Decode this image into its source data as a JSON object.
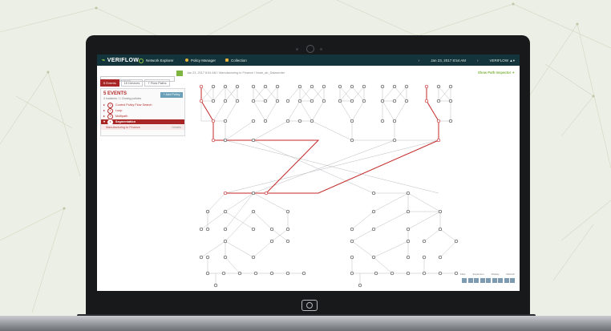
{
  "colors": {
    "accent": "#8fc73e",
    "topbar": "#12343a",
    "danger": "#a82626",
    "node": "#444",
    "path": "#c42a2a"
  },
  "app": {
    "logo": "VERIFLOW"
  },
  "nav": {
    "items": [
      {
        "label": "Network Explorer",
        "icon": "search-icon",
        "color": "#8fc73e"
      },
      {
        "label": "Policy Manager",
        "icon": "shield-icon",
        "color": "#e5b23a"
      },
      {
        "label": "Collection",
        "icon": "folder-icon",
        "color": "#e5b23a"
      }
    ]
  },
  "topright": {
    "date": "Jan 23, 2017 8:54 AM",
    "user": "VERIFLOW"
  },
  "search": {
    "placeholder": "Search the Network"
  },
  "tabs": [
    "5 Events",
    "15 Devices",
    "7 Flow Paths"
  ],
  "events": {
    "title": "5 EVENTS",
    "subtitle": "4 Incidents / 1 Closing policies",
    "add_label": "+ Add Policy",
    "items": [
      {
        "num": "1",
        "label": "Control Policy Flow Search"
      },
      {
        "num": "2",
        "label": "Loop"
      },
      {
        "num": "3",
        "label": "Multipath"
      },
      {
        "num": "4",
        "label": "Segmentation"
      }
    ],
    "sub_item": {
      "label": "Manufacturing to Finance",
      "right": "Details"
    }
  },
  "breadcrumb": "Jan 23, 2017 8:54 AM  /  Manufacturing to Finance  /  Node_ab_Datacenter",
  "inspector": "Show Path Inspector",
  "tool_labels": [
    "Filter",
    "Expansion",
    "Display",
    "Refresh"
  ]
}
